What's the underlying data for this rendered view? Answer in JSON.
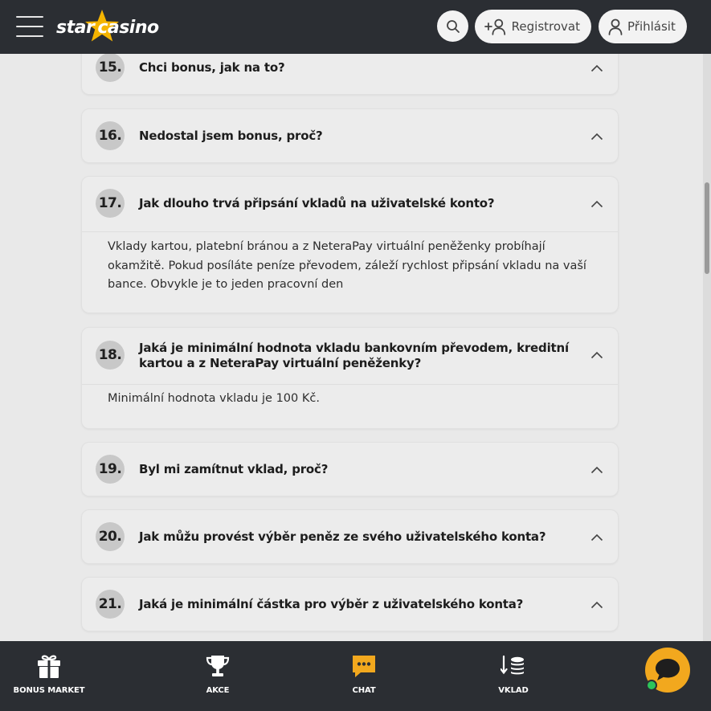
{
  "header": {
    "logo": {
      "star": "star",
      "casino": "casino"
    },
    "register_label": "Registrovat",
    "login_label": "Přihlásit"
  },
  "faq": [
    {
      "num": "15.",
      "question": "Chci bonus, jak na to?",
      "answer": ""
    },
    {
      "num": "16.",
      "question": "Nedostal jsem bonus, proč?",
      "answer": ""
    },
    {
      "num": "17.",
      "question": "Jak dlouho trvá připsání vkladů na uživatelské konto?",
      "answer": "Vklady kartou, platební bránou a z NeteraPay virtuální peněženky probíhají okamžitě. Pokud posíláte peníze převodem, záleží rychlost připsání vkladu na vaší bance. Obvykle je to jeden pracovní den"
    },
    {
      "num": "18.",
      "question": "Jaká je minimální hodnota vkladu bankovním převodem, kreditní kartou a z NeteraPay virtuální peněženky?",
      "answer": "Minimální hodnota vkladu je 100 Kč."
    },
    {
      "num": "19.",
      "question": "Byl mi zamítnut vklad, proč?",
      "answer": ""
    },
    {
      "num": "20.",
      "question": "Jak můžu provést výběr peněz ze svého uživatelského konta?",
      "answer": ""
    },
    {
      "num": "21.",
      "question": "Jaká je minimální částka pro výběr z uživatelského konta?",
      "answer": ""
    }
  ],
  "bottom_nav": [
    {
      "label": "BONUS MARKET",
      "icon": "gift-icon"
    },
    {
      "label": "AKCE",
      "icon": "trophy-icon"
    },
    {
      "label": "CHAT",
      "icon": "chat-icon"
    },
    {
      "label": "VKLAD",
      "icon": "deposit-icon"
    }
  ],
  "colors": {
    "header_bg": "#2b2e33",
    "page_bg": "#e9e9e9",
    "accent_orange": "#f2a81e",
    "star_yellow": "#f5b400",
    "online_green": "#2ec45a"
  }
}
